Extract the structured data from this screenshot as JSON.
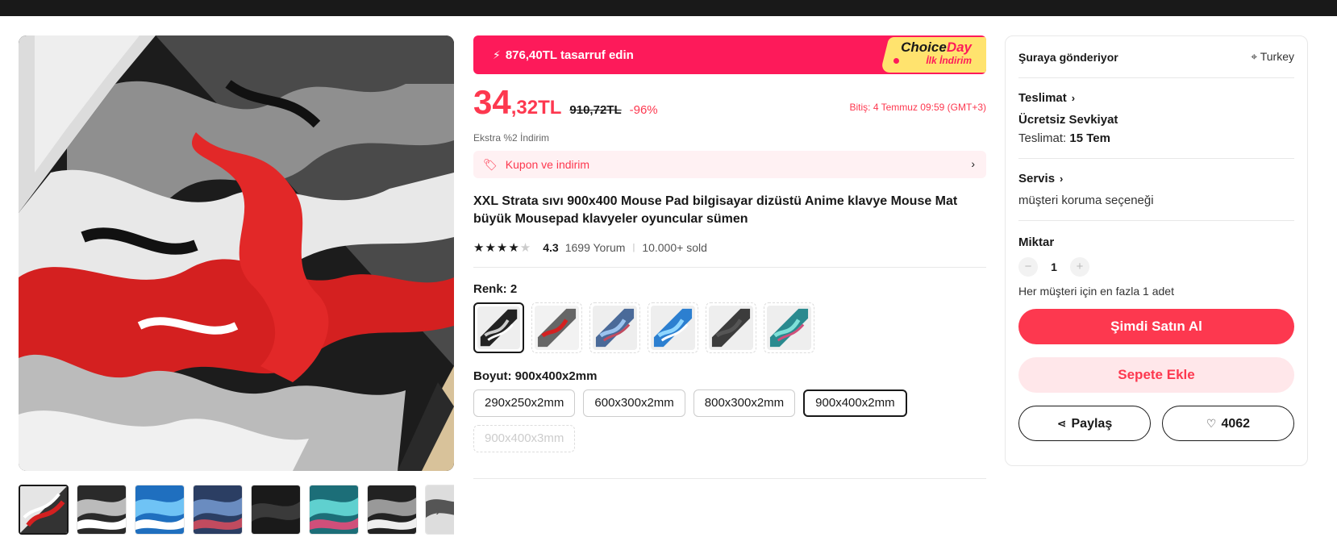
{
  "gallery": {
    "main_image_alt": "",
    "thumb_count": 8
  },
  "banner": {
    "savings": "876,40TL tasarruf edin",
    "badge_line1": "Choice",
    "badge_line1b": "Day",
    "badge_line2": "İlk İndirim"
  },
  "price": {
    "integer": "34",
    "decimal": ",32TL",
    "old": "910,72TL",
    "discount": "-96%",
    "ends": "Bitiş: 4 Temmuz 09:59 (GMT+3)"
  },
  "extra_discount": "Ekstra %2 İndirim",
  "coupon": {
    "label": "Kupon ve indirim"
  },
  "product": {
    "title": "XXL Strata sıvı 900x400 Mouse Pad bilgisayar dizüstü Anime klavye Mouse Mat büyük Mousepad klavyeler oyuncular sümen",
    "rating": "4.3",
    "rating_value": 4.3,
    "reviews": "1699 Yorum",
    "sold": "10.000+ sold"
  },
  "color": {
    "label": "Renk: 2",
    "selected_index": 0,
    "count": 6
  },
  "size": {
    "label": "Boyut: 900x400x2mm",
    "options": [
      "290x250x2mm",
      "600x300x2mm",
      "800x300x2mm",
      "900x400x2mm",
      "900x400x3mm"
    ],
    "selected_index": 3,
    "disabled_index": 4
  },
  "shipping": {
    "ship_to_label": "Şuraya gönderiyor",
    "country": "Turkey",
    "delivery_title": "Teslimat",
    "free_shipping": "Ücretsiz Sevkiyat",
    "delivery_prefix": "Teslimat:",
    "delivery_date": "15 Tem",
    "service_title": "Servis",
    "service_text": "müşteri koruma seçeneği"
  },
  "quantity": {
    "label": "Miktar",
    "value": "1",
    "limit": "Her müşteri için en fazla 1 adet"
  },
  "actions": {
    "buy_now": "Şimdi Satın Al",
    "add_to_cart": "Sepete Ekle",
    "share": "Paylaş",
    "wishlist_count": "4062"
  },
  "colors": {
    "accent": "#fd384f",
    "banner": "#fd1a5a",
    "badge": "#ffe36e"
  }
}
